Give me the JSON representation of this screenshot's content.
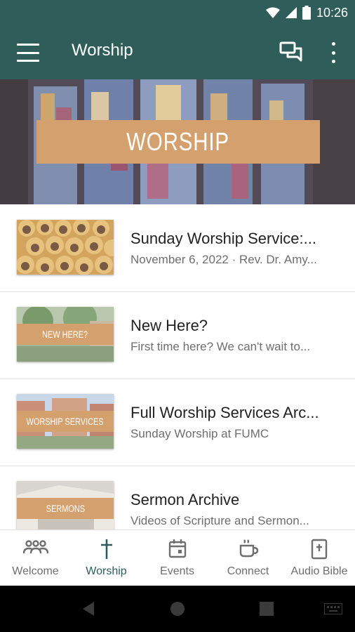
{
  "status_bar": {
    "time": "10:26"
  },
  "app_bar": {
    "title": "Worship"
  },
  "hero": {
    "banner_text": "WORSHIP"
  },
  "items": [
    {
      "title": "Sunday Worship Service:...",
      "subtitle": "November 6, 2022 · Rev. Dr. Amy...",
      "thumb_label": ""
    },
    {
      "title": "New Here?",
      "subtitle": "First time here? We can't wait to...",
      "thumb_label": "NEW HERE?"
    },
    {
      "title": "Full Worship Services Arc...",
      "subtitle": "Sunday Worship at FUMC",
      "thumb_label": "WORSHIP SERVICES"
    },
    {
      "title": "Sermon Archive",
      "subtitle": "Videos of Scripture and Sermon...",
      "thumb_label": "SERMONS"
    }
  ],
  "bottom_nav": {
    "tabs": [
      {
        "label": "Welcome",
        "icon": "people-icon"
      },
      {
        "label": "Worship",
        "icon": "cross-icon"
      },
      {
        "label": "Events",
        "icon": "calendar-icon"
      },
      {
        "label": "Connect",
        "icon": "coffee-cup-icon"
      },
      {
        "label": "Audio Bible",
        "icon": "bible-icon"
      }
    ],
    "active_tab": "Worship"
  },
  "colors": {
    "primary": "#2f5d5a",
    "accent": "#d4a06e",
    "secondary_text": "#6e6e6e"
  }
}
